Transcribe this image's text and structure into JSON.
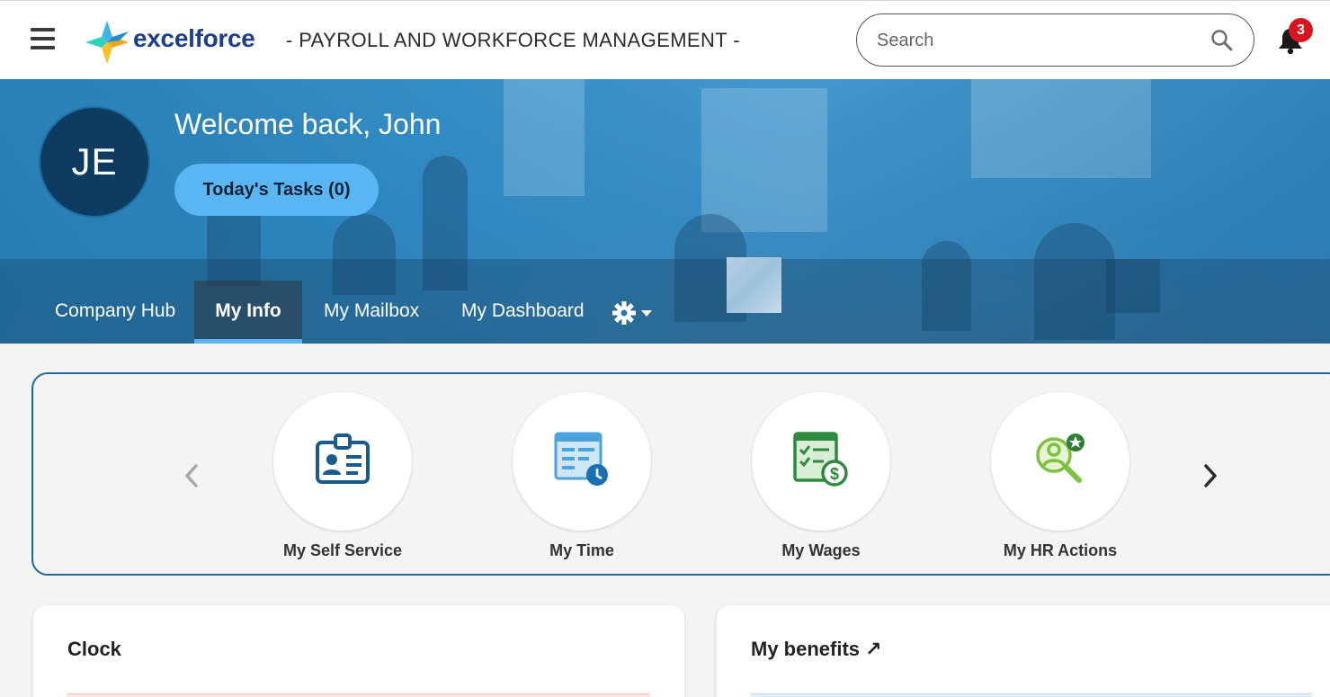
{
  "header": {
    "brand": "excelforce",
    "tagline": "- PAYROLL AND WORKFORCE MANAGEMENT -",
    "search_placeholder": "Search",
    "notification_count": "3",
    "colors": {
      "brand_blue": "#1c3f8c",
      "badge_red": "#d8141f"
    }
  },
  "hero": {
    "avatar_initials": "JE",
    "welcome": "Welcome back, John",
    "tasks_button": "Today's Tasks (0)",
    "accent": "#5ab6f2"
  },
  "nav": {
    "items": [
      {
        "label": "Company Hub"
      },
      {
        "label": "My Info",
        "active": true
      },
      {
        "label": "My Mailbox"
      },
      {
        "label": "My Dashboard"
      }
    ],
    "settings_icon": "gear-icon"
  },
  "quick_links": {
    "items": [
      {
        "label": "My Self Service",
        "icon": "id-badge-icon"
      },
      {
        "label": "My Time",
        "icon": "timesheet-clock-icon"
      },
      {
        "label": "My Wages",
        "icon": "wage-checklist-dollar-icon"
      },
      {
        "label": "My HR Actions",
        "icon": "hr-search-person-icon"
      }
    ]
  },
  "cards": {
    "clock_title": "Clock",
    "benefits_title": "My benefits ↗"
  }
}
